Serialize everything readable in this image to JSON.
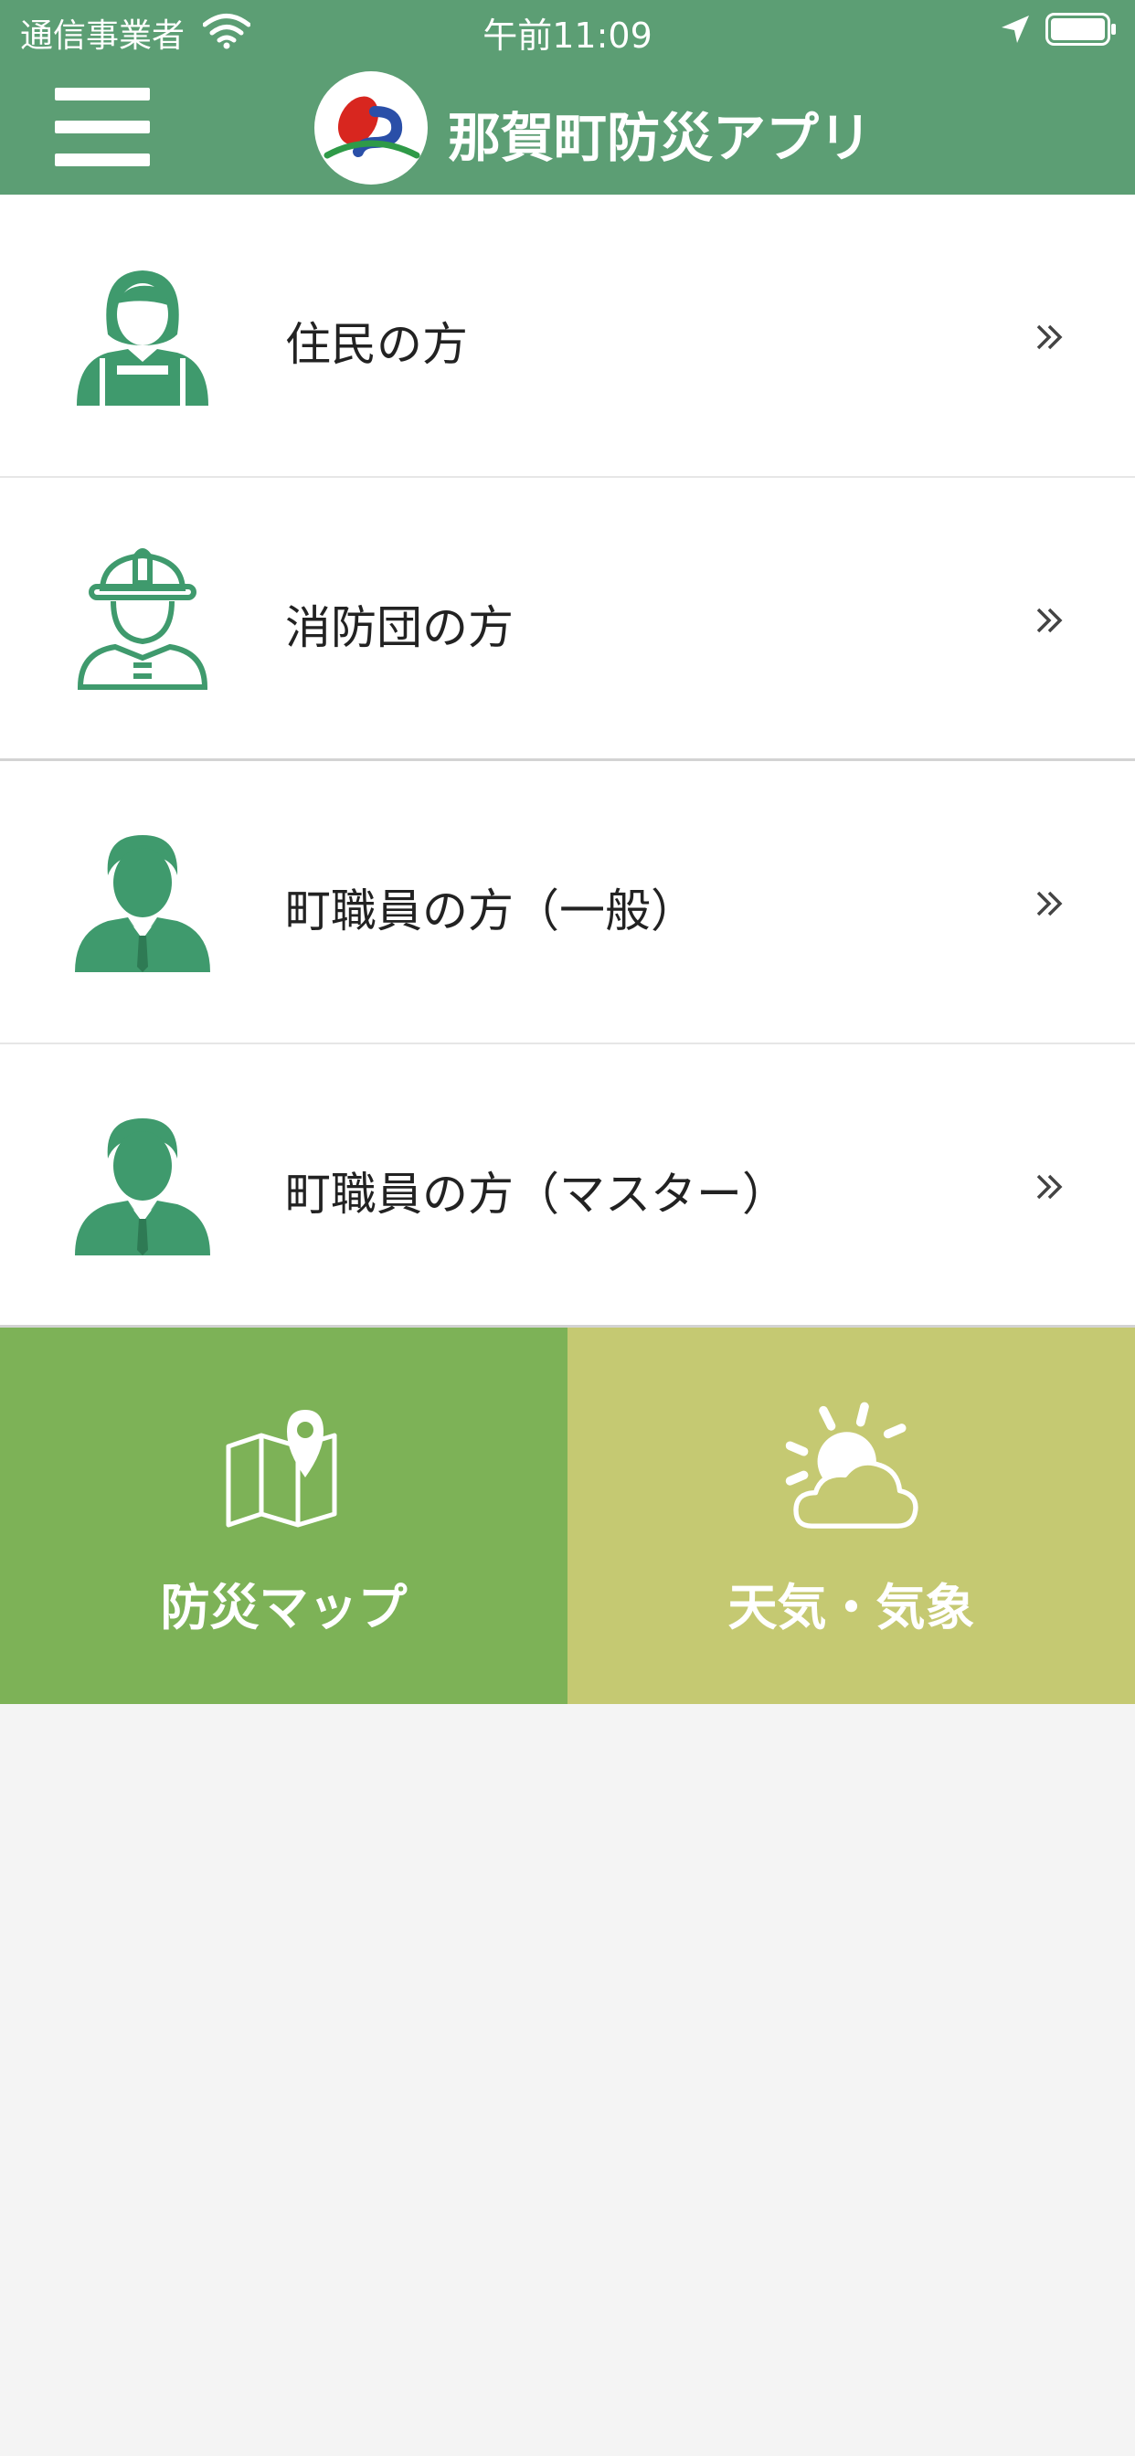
{
  "status_bar": {
    "carrier": "通信事業者",
    "time": "午前11:09"
  },
  "header": {
    "title": "那賀町防災アプリ"
  },
  "colors": {
    "primary_green": "#5c9e74",
    "icon_green": "#3f9a6d",
    "map_tile": "#7db257",
    "weather_tile": "#c5c972"
  },
  "roles": [
    {
      "label": "住民の方",
      "icon": "female-resident-icon"
    },
    {
      "label": "消防団の方",
      "icon": "firefighter-icon"
    },
    {
      "label": "町職員の方（一般）",
      "icon": "male-staff-icon"
    },
    {
      "label": "町職員の方（マスター）",
      "icon": "male-staff-icon"
    }
  ],
  "tiles": {
    "map": {
      "label": "防災マップ",
      "icon": "map-pin-icon"
    },
    "weather": {
      "label": "天気・気象",
      "icon": "sun-cloud-icon"
    }
  }
}
